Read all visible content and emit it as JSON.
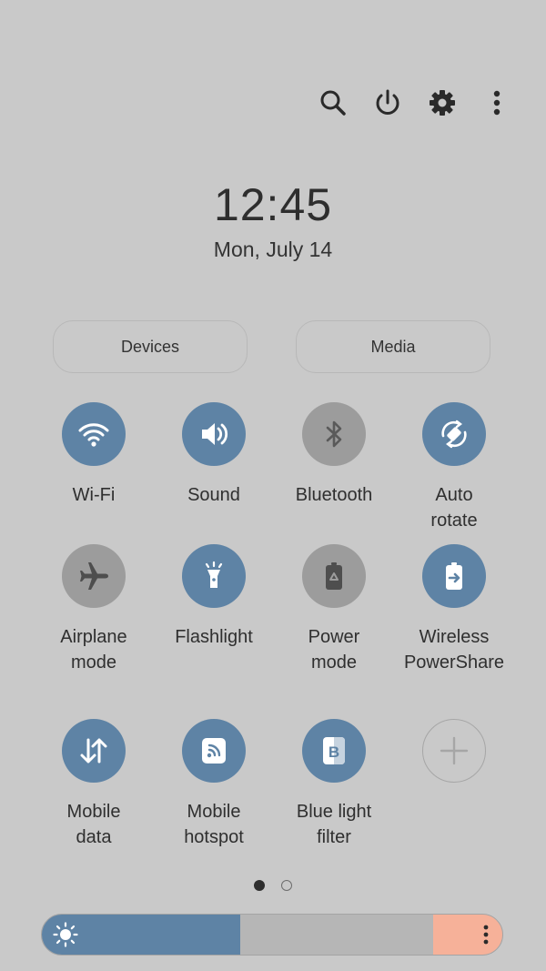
{
  "toolbar": {
    "icons": [
      "search-icon",
      "power-icon",
      "gear-icon",
      "more-vertical-icon"
    ]
  },
  "clock": {
    "time": "12:45",
    "date": "Mon, July 14"
  },
  "panels": {
    "devices_label": "Devices",
    "media_label": "Media"
  },
  "tiles": [
    {
      "label": "Wi-Fi",
      "icon": "wifi-icon",
      "state": "on"
    },
    {
      "label": "Sound",
      "icon": "speaker-icon",
      "state": "on"
    },
    {
      "label": "Bluetooth",
      "icon": "bluetooth-icon",
      "state": "off"
    },
    {
      "label": "Auto\nrotate",
      "icon": "auto-rotate-icon",
      "state": "on"
    },
    {
      "label": "Airplane\nmode",
      "icon": "airplane-icon",
      "state": "off"
    },
    {
      "label": "Flashlight",
      "icon": "flashlight-icon",
      "state": "on"
    },
    {
      "label": "Power\nmode",
      "icon": "battery-recycle-icon",
      "state": "off"
    },
    {
      "label": "Wireless\nPowerShare",
      "icon": "battery-share-icon",
      "state": "on"
    },
    {
      "label": "Mobile\ndata",
      "icon": "data-arrows-icon",
      "state": "on"
    },
    {
      "label": "Mobile\nhotspot",
      "icon": "hotspot-icon",
      "state": "on"
    },
    {
      "label": "Blue light\nfilter",
      "icon": "blue-light-filter-icon",
      "state": "on"
    },
    {
      "label": "",
      "icon": "add-icon",
      "state": "add"
    }
  ],
  "pager": {
    "pages": 2,
    "current": 1
  },
  "brightness": {
    "level": 0.43,
    "icon": "sun-icon",
    "menu_icon": "more-vertical-icon"
  },
  "colors": {
    "background": "#c9c9c9",
    "active_tile": "#5e83a5",
    "inactive_tile": "#9c9c9c",
    "brightness_end": "#f6b199"
  }
}
